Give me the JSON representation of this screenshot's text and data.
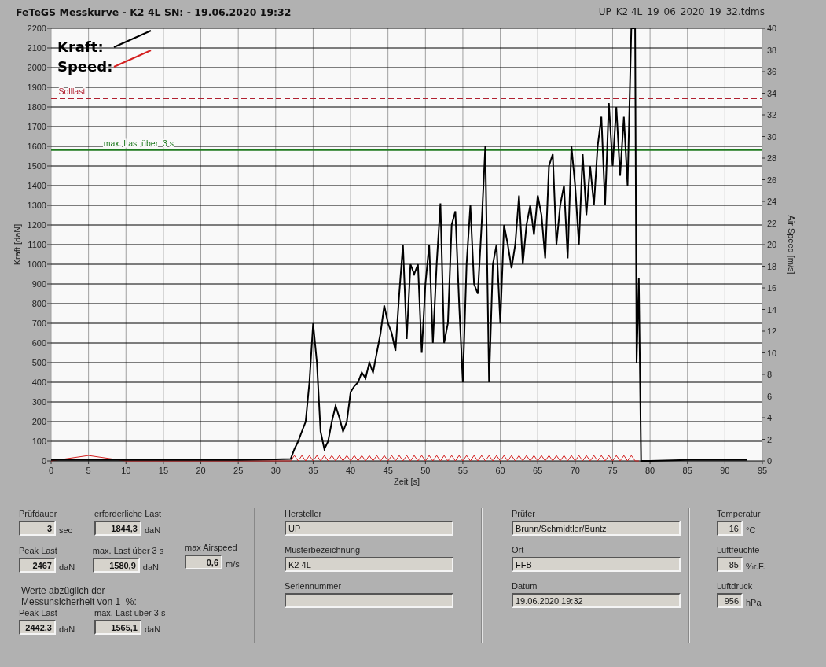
{
  "header": {
    "title": "FeTeGS Messkurve - K2 4L  SN:  - 19.06.2020 19:32",
    "file": "UP_K2 4L_19_06_2020_19_32.tdms"
  },
  "chart": {
    "chart_data": {
      "type": "line",
      "xlabel": "Zeit [s]",
      "ylabel": "Kraft [daN]",
      "y2label": "Air Speed [m/s]",
      "xlim": [
        0,
        95
      ],
      "ylim": [
        0,
        2200
      ],
      "y2lim": [
        0,
        40
      ],
      "grid": true,
      "legend": "upper left",
      "y2ticks": [
        0,
        2,
        4,
        6,
        8,
        10,
        12,
        14,
        16,
        18,
        20,
        22,
        24,
        26,
        28,
        30,
        32,
        34,
        36,
        38,
        40
      ],
      "xticks": [
        0,
        5,
        10,
        15,
        20,
        25,
        30,
        35,
        40,
        45,
        50,
        55,
        60,
        65,
        70,
        75,
        80,
        85,
        90,
        95
      ],
      "yticks": [
        0,
        100,
        200,
        300,
        400,
        500,
        600,
        700,
        800,
        900,
        1000,
        1100,
        1200,
        1300,
        1400,
        1500,
        1600,
        1700,
        1800,
        1900,
        2000,
        2100,
        2200
      ],
      "x": [
        0,
        5,
        10,
        15,
        20,
        25,
        30,
        32,
        32.5,
        33,
        33.5,
        34,
        34.5,
        35,
        35.5,
        36,
        36.5,
        37,
        37.5,
        38,
        38.5,
        39,
        39.5,
        40,
        40.5,
        41,
        41.5,
        42,
        42.5,
        43,
        43.5,
        44,
        44.5,
        45,
        45.5,
        46,
        46.5,
        47,
        47.5,
        48,
        48.5,
        49,
        49.5,
        50,
        50.5,
        51,
        51.5,
        52,
        52.5,
        53,
        53.5,
        54,
        54.5,
        55,
        55.5,
        56,
        56.5,
        57,
        57.5,
        58,
        58.5,
        59,
        59.5,
        60,
        60.5,
        61,
        61.5,
        62,
        62.5,
        63,
        63.5,
        64,
        64.5,
        65,
        65.5,
        66,
        66.5,
        67,
        67.5,
        68,
        68.5,
        69,
        69.5,
        70,
        70.5,
        71,
        71.5,
        72,
        72.5,
        73,
        73.5,
        74,
        74.5,
        75,
        75.5,
        76,
        76.5,
        77,
        77.5,
        78,
        78.2,
        78.5,
        78.8,
        80,
        85,
        90,
        93
      ],
      "series": [
        {
          "name": "Kraft:",
          "color": "#000000",
          "values": [
            5,
            5,
            5,
            5,
            5,
            5,
            8,
            10,
            60,
            100,
            150,
            200,
            400,
            700,
            500,
            150,
            60,
            100,
            200,
            280,
            220,
            150,
            200,
            350,
            380,
            400,
            450,
            420,
            500,
            450,
            550,
            650,
            790,
            700,
            650,
            560,
            850,
            1100,
            620,
            1000,
            950,
            1000,
            550,
            900,
            1100,
            600,
            1000,
            1310,
            600,
            700,
            1200,
            1270,
            800,
            400,
            1000,
            1300,
            900,
            850,
            1200,
            1600,
            400,
            1000,
            1100,
            700,
            1200,
            1100,
            980,
            1100,
            1350,
            1000,
            1200,
            1300,
            1150,
            1350,
            1250,
            1030,
            1500,
            1560,
            1100,
            1300,
            1400,
            1030,
            1600,
            1400,
            1100,
            1560,
            1250,
            1500,
            1300,
            1600,
            1750,
            1300,
            1820,
            1500,
            1800,
            1450,
            1750,
            1400,
            2200,
            2200,
            500,
            930,
            0,
            0,
            5,
            5,
            5
          ]
        },
        {
          "name": "Speed:",
          "color": "#d42020",
          "axis": "y2",
          "values": [
            0,
            0.5,
            0,
            0,
            0,
            0,
            0,
            0,
            0.5,
            0,
            0.5,
            0,
            0.5,
            0,
            0.5,
            0,
            0.5,
            0,
            0.5,
            0,
            0.5,
            0,
            0.5,
            0,
            0.5,
            0,
            0.5,
            0,
            0.5,
            0,
            0.5,
            0,
            0.5,
            0,
            0.5,
            0,
            0.5,
            0,
            0.5,
            0,
            0.5,
            0,
            0.5,
            0,
            0.5,
            0,
            0.5,
            0,
            0.5,
            0,
            0.5,
            0,
            0.5,
            0,
            0.5,
            0,
            0.5,
            0,
            0.5,
            0,
            0.5,
            0,
            0.5,
            0,
            0.5,
            0,
            0.5,
            0,
            0.5,
            0,
            0.5,
            0,
            0.5,
            0,
            0.5,
            0,
            0.5,
            0,
            0.5,
            0,
            0.5,
            0,
            0.5,
            0,
            0.5,
            0,
            0.5,
            0,
            0.5,
            0,
            0.5,
            0,
            0.5,
            0,
            0.5,
            0,
            0.5,
            0,
            0.5,
            0,
            0,
            0,
            null,
            null,
            null,
            null,
            null
          ]
        }
      ],
      "ref_lines": [
        {
          "axis": "y",
          "value": 1844.3,
          "label": "Solllast",
          "color": "#b02030"
        },
        {
          "axis": "y",
          "value": 1580.9,
          "label": "max. Last über  3 s",
          "color": "#1f7a1f"
        }
      ]
    }
  },
  "results": {
    "rows": [
      [
        {
          "label": "Prüfdauer",
          "value": "3",
          "unit": "sec"
        },
        {
          "label": "erforderliche Last",
          "value": "1844,3",
          "unit": "daN"
        }
      ],
      [
        {
          "label": "Peak Last",
          "value": "2467",
          "unit": "daN"
        },
        {
          "label": "max. Last über  3 s",
          "value": "1580,9",
          "unit": "daN"
        },
        {
          "label": "max Airspeed",
          "value": "0,6",
          "unit": "m/s"
        }
      ]
    ],
    "note": "Werte abzüglich der\nMessunsicherheit von 1  %:",
    "corrected": [
      {
        "label": "Peak Last",
        "value": "2442,3",
        "unit": "daN"
      },
      {
        "label": "max. Last über  3 s",
        "value": "1565,1",
        "unit": "daN"
      }
    ]
  },
  "sample": [
    {
      "label": "Hersteller",
      "value": "UP"
    },
    {
      "label": "Musterbezeichnung",
      "value": "K2 4L"
    },
    {
      "label": "Seriennummer"
    }
  ],
  "test": [
    {
      "label": "Prüfer",
      "value": "Brunn/Schmidtler/Buntz"
    },
    {
      "label": "Ort",
      "value": "FFB"
    },
    {
      "label": "Datum",
      "value": "19.06.2020 19:32"
    }
  ],
  "conditions": [
    {
      "label": "Temperatur",
      "value": "16",
      "unit": "°C"
    },
    {
      "label": "Luftfeuchte",
      "value": "85",
      "unit": "%r.F."
    },
    {
      "label": "Luftdruck",
      "value": "956",
      "unit": "hPa"
    }
  ]
}
